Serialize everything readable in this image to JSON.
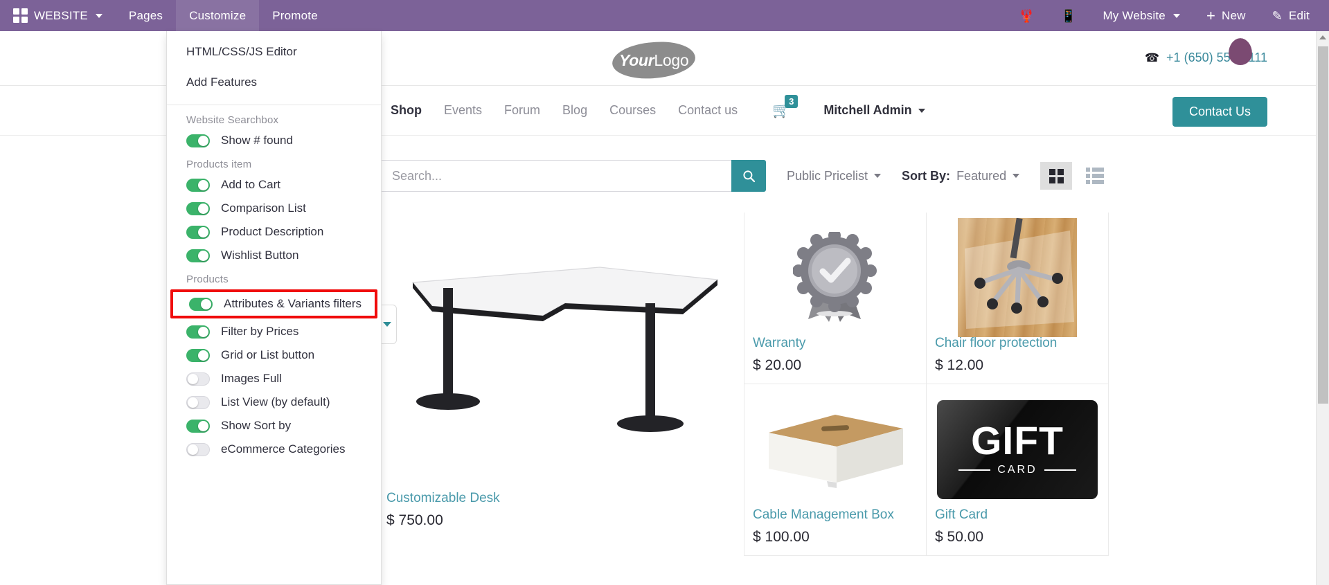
{
  "topbar": {
    "apps_icon": "apps-grid-icon",
    "brand": "WEBSITE",
    "menus": [
      {
        "label": "Pages",
        "active": false
      },
      {
        "label": "Customize",
        "active": true
      },
      {
        "label": "Promote",
        "active": false
      }
    ],
    "bug_icon": "bug-icon",
    "mobile_icon": "mobile-preview-icon",
    "website_selector": "My Website",
    "new_label": "New",
    "new_icon": "plus-icon",
    "edit_label": "Edit",
    "edit_icon": "pencil-icon",
    "bg_color": "#7c6298"
  },
  "customize_menu": {
    "links": [
      "HTML/CSS/JS Editor",
      "Add Features"
    ],
    "groups": [
      {
        "title": "Website Searchbox",
        "options": [
          {
            "label": "Show # found",
            "on": true,
            "highlighted": false
          }
        ]
      },
      {
        "title": "Products item",
        "options": [
          {
            "label": "Add to Cart",
            "on": true,
            "highlighted": false
          },
          {
            "label": "Comparison List",
            "on": true,
            "highlighted": false
          },
          {
            "label": "Product Description",
            "on": true,
            "highlighted": false
          },
          {
            "label": "Wishlist Button",
            "on": true,
            "highlighted": false
          }
        ]
      },
      {
        "title": "Products",
        "options": [
          {
            "label": "Attributes & Variants filters",
            "on": true,
            "highlighted": true
          },
          {
            "label": "Filter by Prices",
            "on": true,
            "highlighted": false
          },
          {
            "label": "Grid or List button",
            "on": true,
            "highlighted": false
          },
          {
            "label": "Images Full",
            "on": false,
            "highlighted": false
          },
          {
            "label": "List View (by default)",
            "on": false,
            "highlighted": false
          },
          {
            "label": "Show Sort by",
            "on": true,
            "highlighted": false
          },
          {
            "label": "eCommerce Categories",
            "on": false,
            "highlighted": false
          }
        ]
      }
    ],
    "highlight_color": "#f00b0b",
    "toggle_on_color": "#3bb36a"
  },
  "site_header": {
    "logo_your": "Your",
    "logo_logo": "Logo",
    "phone": "+1 (650) 555-0111",
    "phone_icon": "phone-icon",
    "nav": [
      {
        "label": "Shop",
        "active": true
      },
      {
        "label": "Events",
        "active": false
      },
      {
        "label": "Forum",
        "active": false
      },
      {
        "label": "Blog",
        "active": false
      },
      {
        "label": "Courses",
        "active": false
      },
      {
        "label": "Contact us",
        "active": false
      }
    ],
    "cart_icon": "shopping-cart-icon",
    "cart_count": "3",
    "user_name": "Mitchell Admin",
    "contact_button": "Contact Us",
    "accent_color": "#2f9099"
  },
  "shop_toolbar": {
    "search_placeholder": "Search...",
    "search_value": "",
    "search_icon": "search-icon",
    "pricelist_label": "Public Pricelist",
    "sort_prefix": "Sort By:",
    "sort_value": "Featured",
    "grid_view_icon": "grid-view-icon",
    "list_view_icon": "list-view-icon",
    "active_view": "grid"
  },
  "products": {
    "featured": {
      "name": "Customizable Desk",
      "price": "$ 750.00",
      "image": "desk-image"
    },
    "items": [
      {
        "name": "Warranty",
        "price": "$ 20.00",
        "image": "warranty-badge-image"
      },
      {
        "name": "Chair floor protection",
        "price": "$ 12.00",
        "image": "chair-floor-mat-image"
      },
      {
        "name": "Cable Management Box",
        "price": "$ 100.00",
        "image": "cable-box-image"
      },
      {
        "name": "Gift Card",
        "price": "$ 50.00",
        "image": "gift-card-image"
      }
    ],
    "gift_card_text": {
      "title": "GIFT",
      "subtitle": "CARD"
    },
    "link_color": "#4a9aab"
  },
  "scrollbar": {
    "up_arrow_icon": "scroll-up-arrow-icon"
  }
}
